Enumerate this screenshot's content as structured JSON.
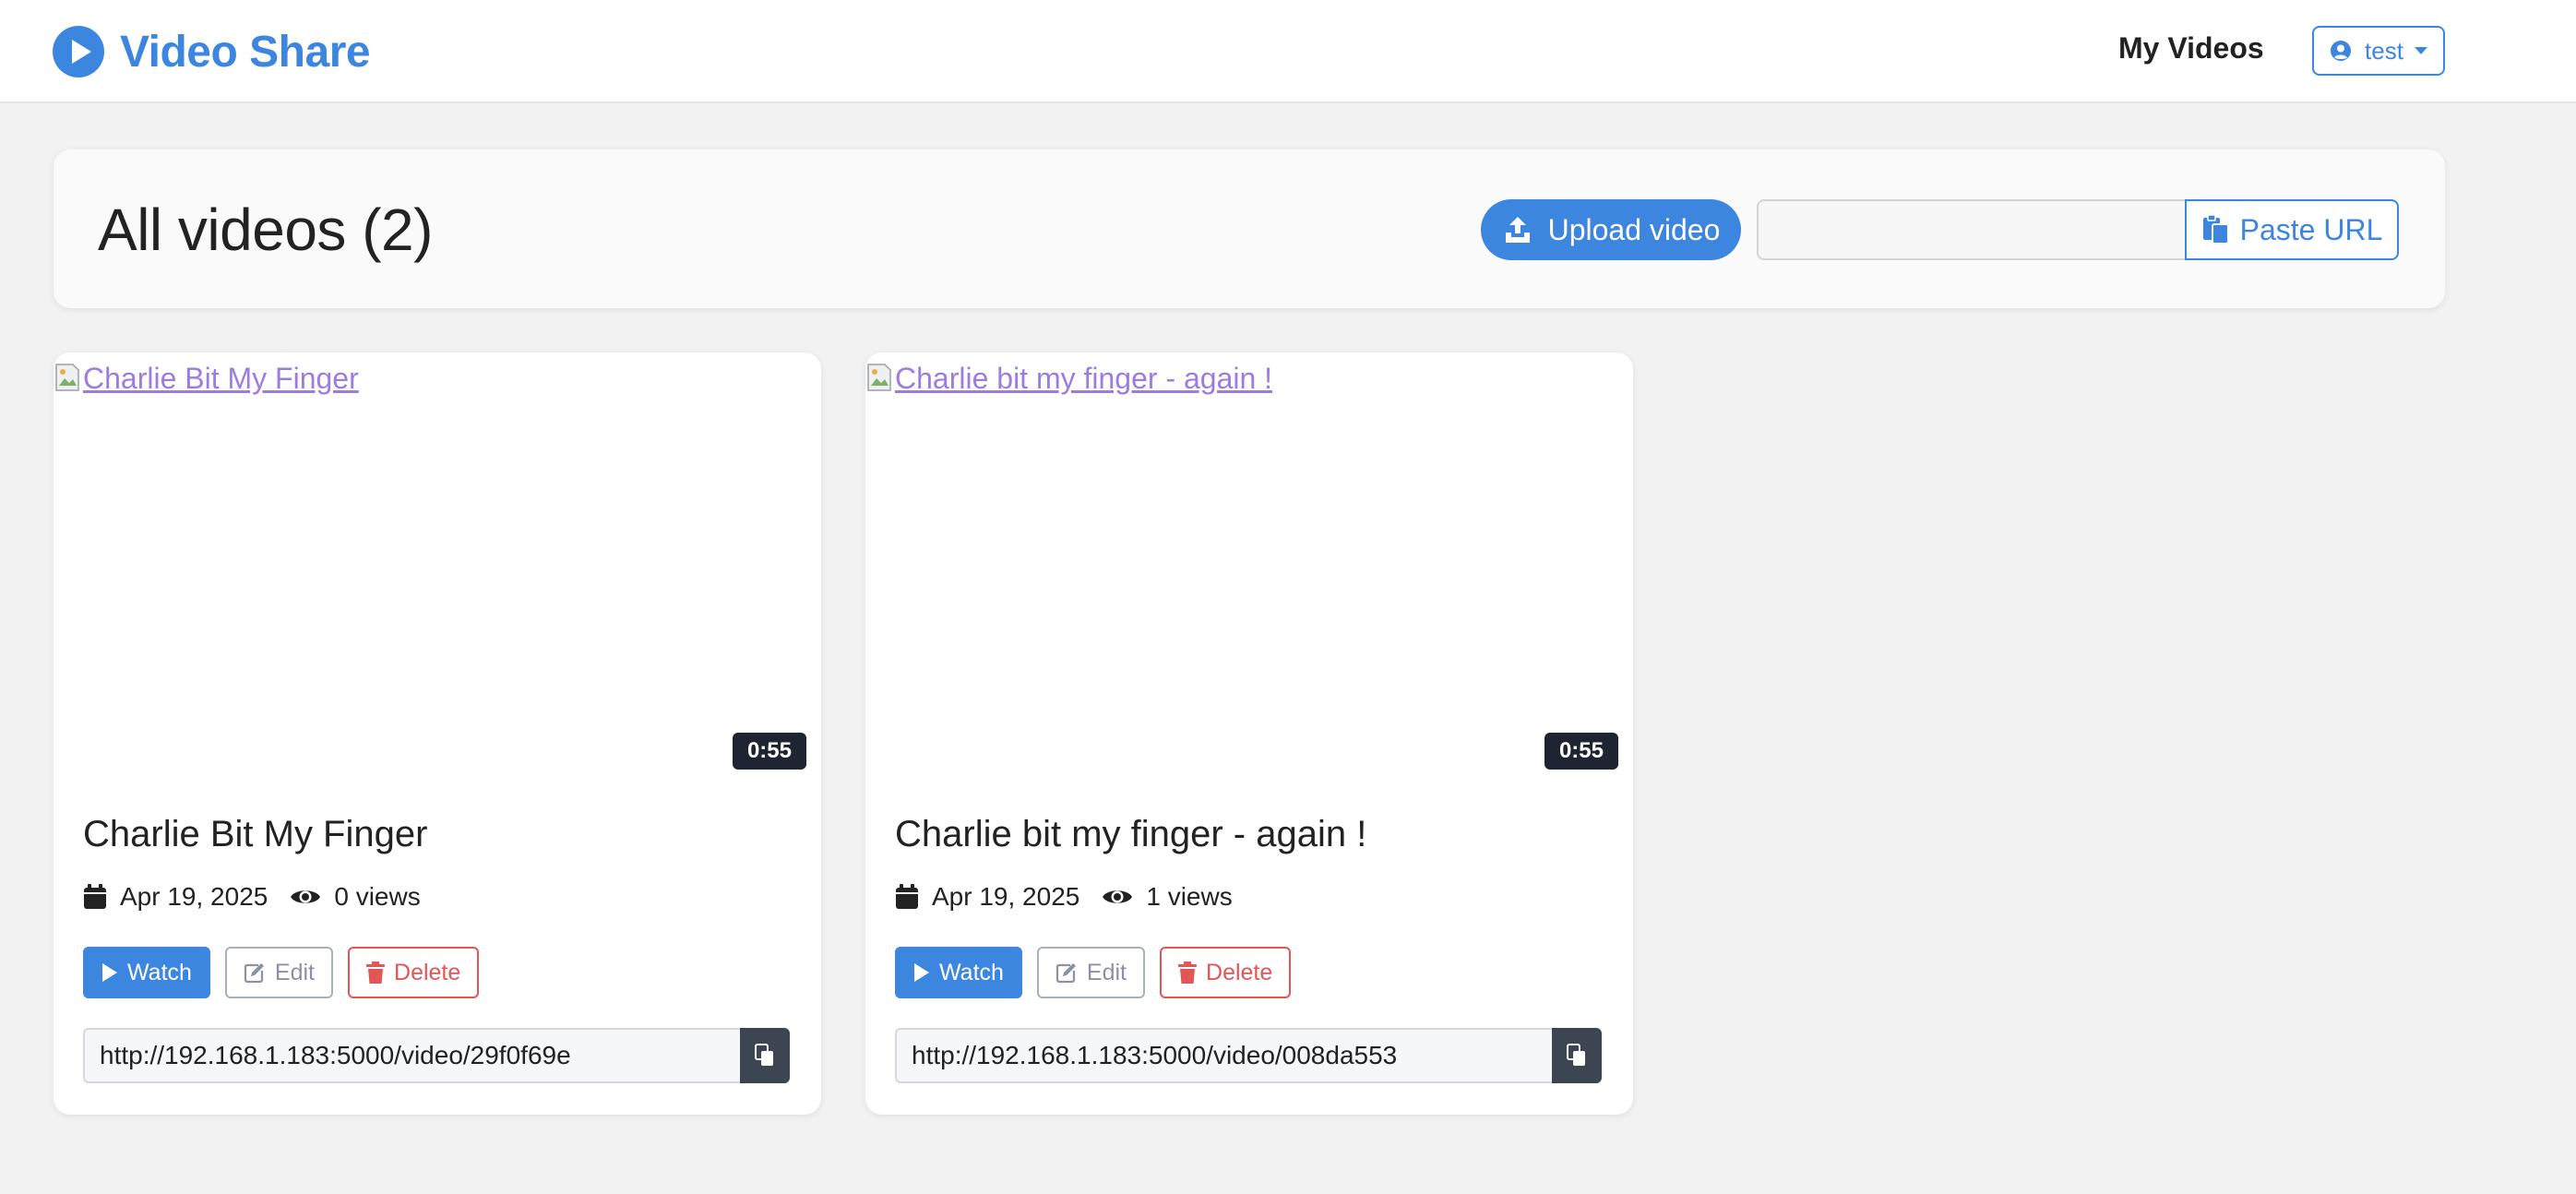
{
  "navbar": {
    "brand": "Video Share",
    "my_videos": "My Videos",
    "user": "test"
  },
  "header": {
    "title": "All videos (2)",
    "upload_label": "Upload video",
    "url_input_value": "",
    "paste_label": "Paste URL"
  },
  "videos": [
    {
      "thumb_alt": "Charlie Bit My Finger",
      "duration": "0:55",
      "title": "Charlie Bit My Finger",
      "date": "Apr 19, 2025",
      "views": "0 views",
      "watch": "Watch",
      "edit": "Edit",
      "delete": "Delete",
      "link": "http://192.168.1.183:5000/video/29f0f69e"
    },
    {
      "thumb_alt": "Charlie bit my finger - again !",
      "duration": "0:55",
      "title": "Charlie bit my finger - again !",
      "date": "Apr 19, 2025",
      "views": "1 views",
      "watch": "Watch",
      "edit": "Edit",
      "delete": "Delete",
      "link": "http://192.168.1.183:5000/video/008da553"
    }
  ],
  "colors": {
    "accent": "#3d86e0",
    "danger": "#e45555",
    "duration_bg": "#1f2433",
    "link": "#9c7be3"
  },
  "icons": {
    "brand": "play-circle-icon",
    "user": "user-circle-icon",
    "upload": "upload-icon",
    "paste": "paste-icon",
    "date": "calendar-icon",
    "views": "eye-icon",
    "watch": "play-icon",
    "edit": "edit-icon",
    "delete": "trash-icon",
    "copy": "copy-icon"
  }
}
